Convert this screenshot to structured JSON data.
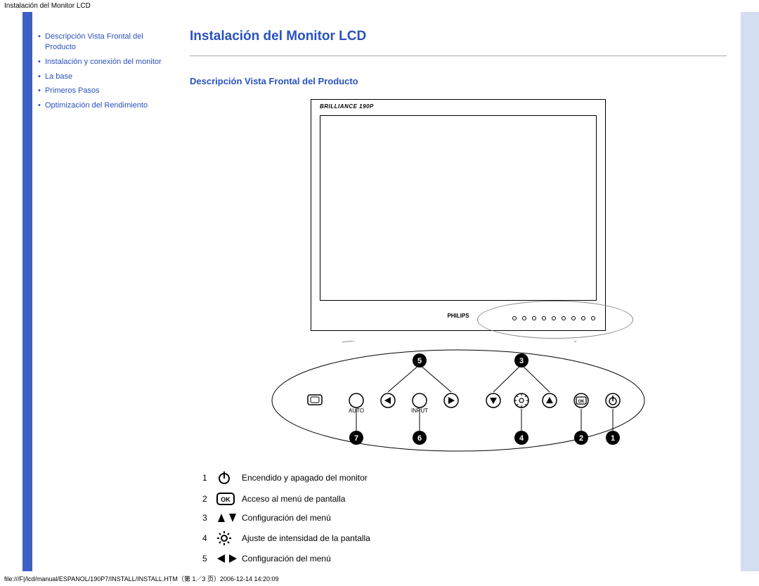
{
  "headerTitle": "Instalación del Monitor LCD",
  "sidebar": {
    "items": [
      {
        "label": "Descripción Vista Frontal del Producto"
      },
      {
        "label": "Instalación y conexión del monitor"
      },
      {
        "label": "La base"
      },
      {
        "label": "Primeros Pasos"
      },
      {
        "label": "Optimización del Rendimiento"
      }
    ]
  },
  "main": {
    "pageTitle": "Instalación del Monitor LCD",
    "sectionTitle": "Descripción Vista Frontal del Producto",
    "monitor": {
      "brandTop": "BRILLIANCE 190P",
      "brandBottom": "PHILIPS",
      "frontLabels": [
        "",
        "AUTO",
        "◄ INPUT ►",
        "",
        "",
        "",
        "☼",
        "OK",
        "⏻"
      ]
    },
    "panel": {
      "callouts": {
        "topLeft": "5",
        "topRight": "3",
        "bottomFarLeft": "7",
        "bottomLeft2": "6",
        "bottomMid": "4",
        "bottomRight2": "2",
        "bottomFarRight": "1"
      },
      "rowLabels": {
        "auto": "AUTO",
        "input": "INPUT"
      }
    },
    "legend": [
      {
        "num": "1",
        "icon": "power-icon",
        "text": "Encendido y apagado del monitor"
      },
      {
        "num": "2",
        "icon": "ok-icon",
        "text": "Acceso al menú de pantalla"
      },
      {
        "num": "3",
        "icon": "updown-icon",
        "text": "Configuración del menú"
      },
      {
        "num": "4",
        "icon": "brightness-icon",
        "text": "Ajuste de intensidad de la pantalla"
      },
      {
        "num": "5",
        "icon": "leftright-icon",
        "text": "Configuración del menú"
      }
    ]
  },
  "footerPath": "file:///F|/lcd/manual/ESPANOL/190P7/INSTALL/INSTALL.HTM（第 1／3 页）2006-12-14 14:20:09"
}
